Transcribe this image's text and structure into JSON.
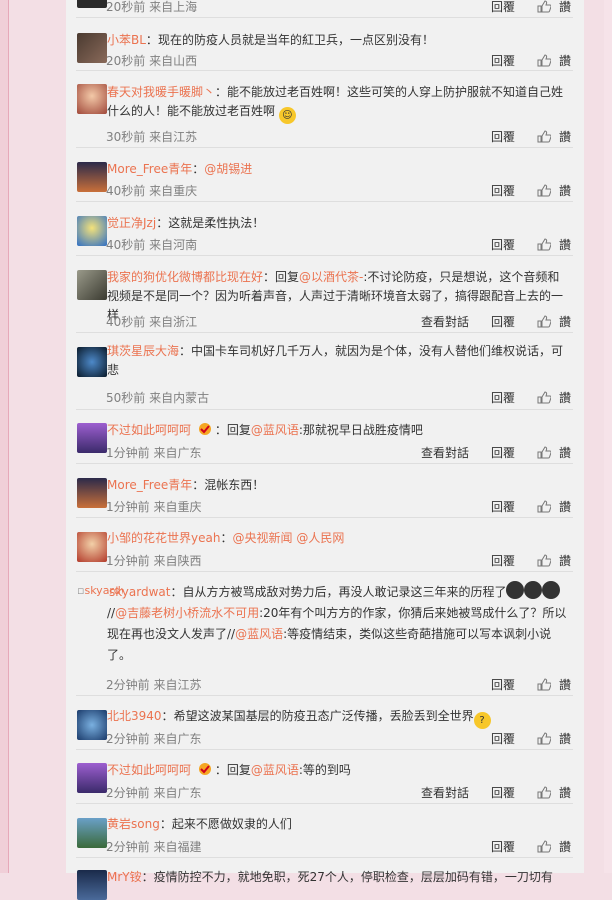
{
  "labels": {
    "reply": "回覆",
    "report": "讚",
    "view_convo": "查看對話"
  },
  "top_meta": "20秒前 来自上海",
  "comments": [
    {
      "nick": "小苯BL",
      "sep": "：",
      "text": "现在的防疫人员就是当年的紅卫兵，一点区别没有！",
      "meta": "20秒前 来自山西"
    },
    {
      "nick": "春天对我暖手暖脚丶",
      "sep": "：",
      "text": "能不能放过老百姓啊！这些可笑的人穿上防护服就不知道自己姓什么的人！能不能放过老百姓啊",
      "meta": "30秒前 来自江苏"
    },
    {
      "nick": "More_Free青年",
      "sep": "：",
      "mention": "@胡锡进",
      "meta": "40秒前 来自重庆"
    },
    {
      "nick": "觉正净Jzj",
      "sep": "：",
      "text": "这就是柔性执法！",
      "meta": "40秒前 来自河南"
    },
    {
      "nick": "我家的狗优化微博都比现在好",
      "sep": "：回复",
      "mention": "@以酒代茶-",
      "text": ":不讨论防疫，只是想说，这个音频和视频是不是同一个？因为听着声音，人声过于清晰环境音太弱了，搞得跟配音上去的一样",
      "meta": "40秒前 来自浙江"
    },
    {
      "nick": "琪茨星辰大海",
      "sep": "：",
      "text": "中国卡车司机好几千万人，就因为是个体，没有人替他们维权说话，可悲",
      "meta": "50秒前 来自内蒙古"
    },
    {
      "nick": "不过如此呵呵呵",
      "sep": "：回复",
      "mention": "@蓝风语",
      "text": ":那就祝早日战胜疫情吧",
      "meta": "1分钟前 来自广东"
    },
    {
      "nick": "More_Free青年",
      "sep": "：",
      "text": "混帐东西！",
      "meta": "1分钟前 来自重庆"
    },
    {
      "nick": "小邹的花花世界yeah",
      "sep": "：",
      "mention": "@央视新闻",
      "mention2": "@人民网",
      "meta": "1分钟前 来自陕西"
    },
    {
      "nick": "skyardwat",
      "sep": "：",
      "text": "自从方方被骂成敌对势力后，再没人敢记录这三年来的历程了",
      "avatar_alt": "skyardwat",
      "text2_prefix": "//",
      "mention": "@吉藤老树小桥流水不可用",
      "text2": ":20年有个叫方方的作家，你猜后来她被骂成什么了？所以现在再也没文人发声了//",
      "mention2": "@蓝风语",
      "text3": ":等疫情结束，类似这些奇葩措施可以写本讽刺小说了。",
      "meta": "2分钟前 来自江苏"
    },
    {
      "nick": "北北3940",
      "sep": "：",
      "text": "希望这波某国基层的防疫丑态广泛传播，丢脸丢到全世界",
      "meta": "2分钟前 来自广东"
    },
    {
      "nick": "不过如此呵呵呵",
      "sep": "：回复",
      "mention": "@蓝风语",
      "text": ":等的到吗",
      "meta": "2分钟前 来自广东"
    },
    {
      "nick": "黄岩song",
      "sep": "：",
      "text": "起来不愿做奴隶的人们",
      "meta": "2分钟前 来自福建"
    },
    {
      "nick": "MrY铵",
      "sep": "：",
      "text": "疫情防控不力，就地免职，死27个人，停职检查，层层加码有错，一刀切有"
    }
  ],
  "colors": {
    "link": "#eb7350",
    "meta": "#808080",
    "panel": "#f1f1f1",
    "page_bg": "#f3dfe5"
  }
}
